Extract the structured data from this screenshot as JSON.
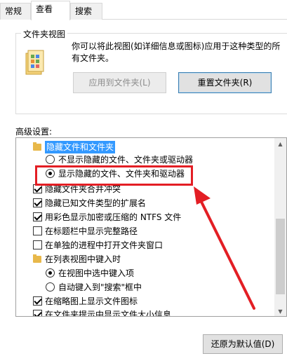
{
  "tabs": [
    "常规",
    "查看",
    "搜索"
  ],
  "folder_views": {
    "legend": "文件夹视图",
    "description": "你可以将此视图(如详细信息或图标)应用于这种类型的所有文件夹。",
    "apply_button": "应用到文件夹(L)",
    "reset_button": "重置文件夹(R)"
  },
  "advanced": {
    "label": "高级设置:",
    "items": [
      {
        "type": "folder",
        "label": "隐藏文件和文件夹",
        "selected": true
      },
      {
        "type": "radio",
        "checked": false,
        "label": "不显示隐藏的文件、文件夹或驱动器"
      },
      {
        "type": "radio",
        "checked": true,
        "label": "显示隐藏的文件、文件夹和驱动器"
      },
      {
        "type": "checkbox",
        "checked": true,
        "label": "隐藏文件夹合并冲突"
      },
      {
        "type": "checkbox",
        "checked": true,
        "label": "隐藏已知文件类型的扩展名"
      },
      {
        "type": "checkbox",
        "checked": true,
        "label": "用彩色显示加密或压缩的 NTFS 文件"
      },
      {
        "type": "checkbox",
        "checked": false,
        "label": "在标题栏中显示完整路径"
      },
      {
        "type": "checkbox",
        "checked": false,
        "label": "在单独的进程中打开文件夹窗口"
      },
      {
        "type": "folder",
        "label": "在列表视图中键入时"
      },
      {
        "type": "radio",
        "checked": true,
        "label": "在视图中选中键入项"
      },
      {
        "type": "radio",
        "checked": false,
        "label": "自动键入到\"搜索\"框中"
      },
      {
        "type": "checkbox",
        "checked": true,
        "label": "在缩略图上显示文件图标"
      },
      {
        "type": "checkbox",
        "checked": true,
        "label": "在文件夹提示中显示文件大小信息"
      }
    ]
  },
  "restore_button": "还原为默认值(D)",
  "annotation_color": "#e31e24"
}
